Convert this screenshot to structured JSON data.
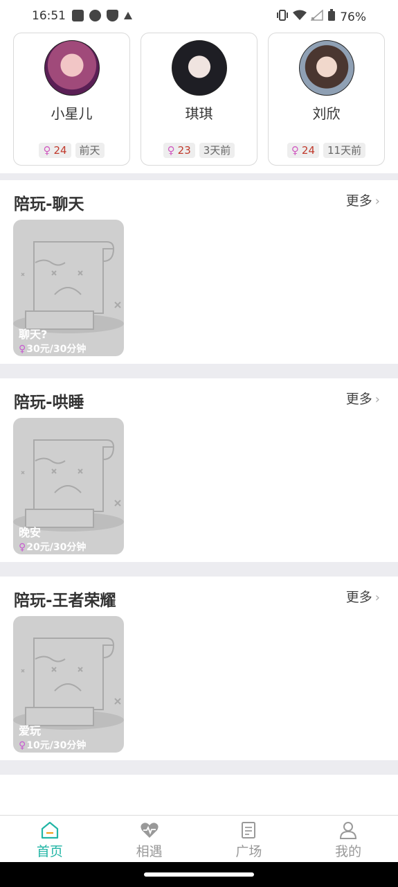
{
  "status_bar": {
    "time": "16:51",
    "battery": "76%"
  },
  "recent_users": [
    {
      "name": "小星儿",
      "age": "24",
      "last_seen": "前天"
    },
    {
      "name": "琪琪",
      "age": "23",
      "last_seen": "3天前"
    },
    {
      "name": "刘欣",
      "age": "24",
      "last_seen": "11天前"
    }
  ],
  "gender_symbol": "♀",
  "more_label": "更多",
  "sections": [
    {
      "title": "陪玩-聊天",
      "card": {
        "title": "聊天?",
        "price": "30元/30分钟"
      }
    },
    {
      "title": "陪玩-哄睡",
      "card": {
        "title": "晚安",
        "price": "20元/30分钟"
      }
    },
    {
      "title": "陪玩-王者荣耀",
      "card": {
        "title": "爱玩",
        "price": "10元/30分钟"
      }
    }
  ],
  "tabs": [
    {
      "label": "首页",
      "icon": "home-icon",
      "active": true
    },
    {
      "label": "相遇",
      "icon": "heart-pulse-icon",
      "active": false
    },
    {
      "label": "广场",
      "icon": "square-clipboard-icon",
      "active": false
    },
    {
      "label": "我的",
      "icon": "profile-icon",
      "active": false
    }
  ],
  "colors": {
    "accent": "#21b5a5",
    "female": "#d05ac0",
    "age_text": "#c0392b",
    "divider": "#ececf0"
  }
}
